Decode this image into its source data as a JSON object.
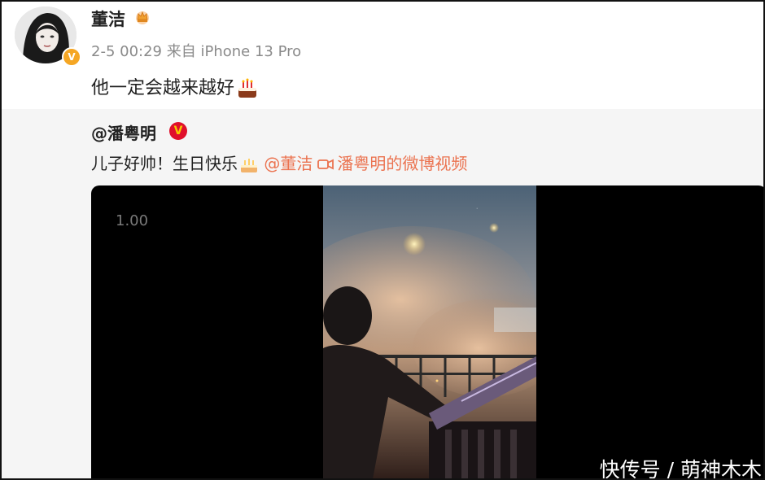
{
  "post": {
    "author": "董洁",
    "crown_icon": "crown-icon",
    "time": "2-5 00:29",
    "source_prefix": "来自",
    "device": "iPhone 13 Pro",
    "text": "他一定会越来越好",
    "emoji": "cake-icon",
    "verified_badge": "V"
  },
  "repost": {
    "author": "@潘粤明",
    "verified_badge": "V",
    "text": "儿子好帅！生日快乐",
    "mention": "@董洁",
    "video_link": "潘粤明的微博视频",
    "link_color": "#eb7350"
  },
  "video": {
    "speed": "1.00",
    "overlay_text": "快传号 / 萌神木木"
  }
}
